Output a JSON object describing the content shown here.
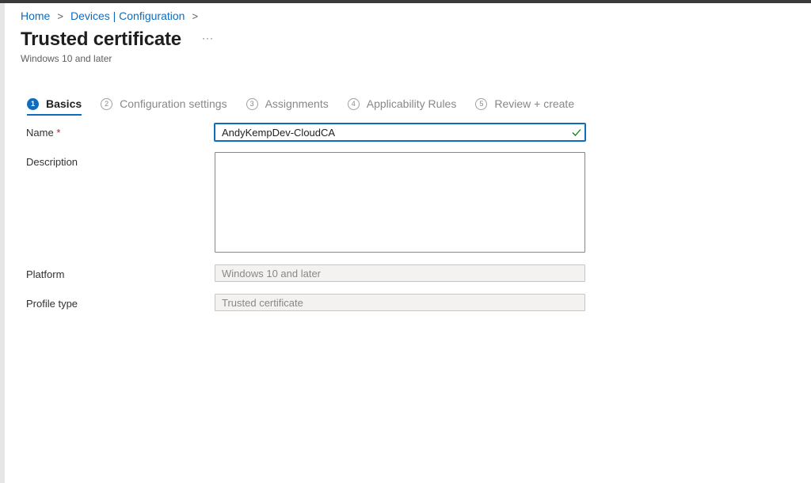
{
  "breadcrumb": {
    "items": [
      "Home",
      "Devices | Configuration"
    ],
    "separator": ">"
  },
  "header": {
    "title": "Trusted certificate",
    "more": "···",
    "subtitle": "Windows 10 and later"
  },
  "wizard": {
    "steps": [
      {
        "number": "1",
        "label": "Basics"
      },
      {
        "number": "2",
        "label": "Configuration settings"
      },
      {
        "number": "3",
        "label": "Assignments"
      },
      {
        "number": "4",
        "label": "Applicability Rules"
      },
      {
        "number": "5",
        "label": "Review + create"
      }
    ],
    "active_step": 1
  },
  "form": {
    "name_label": "Name",
    "required_mark": "*",
    "name_value": "AndyKempDev-CloudCA",
    "name_valid_icon": "checkmark-icon",
    "description_label": "Description",
    "description_value": "",
    "platform_label": "Platform",
    "platform_value": "Windows 10 and later",
    "profile_type_label": "Profile type",
    "profile_type_value": "Trusted certificate"
  },
  "colors": {
    "accent": "#0f6cbd",
    "valid": "#107c10",
    "required": "#a4262c"
  }
}
